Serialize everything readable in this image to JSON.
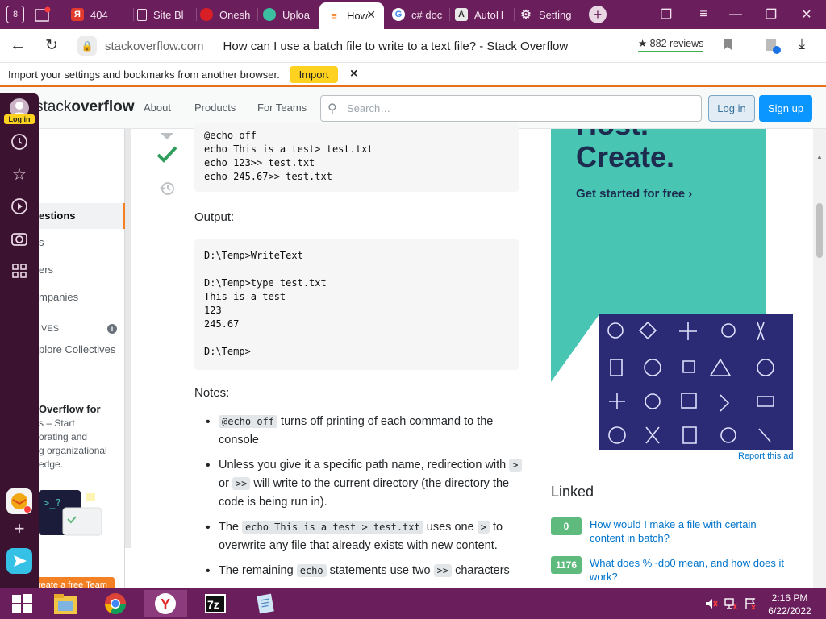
{
  "browser": {
    "tabs": [
      {
        "label": "404",
        "icon": "yandex-icon"
      },
      {
        "label": "Site Bl",
        "icon": "page-icon"
      },
      {
        "label": "Onesh",
        "icon": "red-shoe-icon"
      },
      {
        "label": "Uploa",
        "icon": "cloud-icon"
      },
      {
        "label": "How",
        "icon": "stackoverflow-icon",
        "active": true
      },
      {
        "label": "c# doc",
        "icon": "google-icon"
      },
      {
        "label": "AutoH",
        "icon": "autohotkey-icon"
      },
      {
        "label": "Setting",
        "icon": "gear-icon"
      }
    ],
    "tab_counter": "8",
    "domain": "stackoverflow.com",
    "page_title": "How can I use a batch file to write to a text file? - Stack Overflow",
    "reviews": "★ 882 reviews",
    "infobar_text": "Import your settings and bookmarks from another browser.",
    "infobar_button": "Import",
    "infobar_close": "×",
    "login_badge": "Log in"
  },
  "so": {
    "logo_text_a": "stack",
    "logo_text_b": "overflow",
    "nav": [
      "About",
      "Products",
      "For Teams"
    ],
    "search_placeholder": "Search…",
    "login": "Log in",
    "signup": "Sign up",
    "left_nav": {
      "questions": "estions",
      "tags": "s",
      "users": "ers",
      "companies": "mpanies",
      "collectives_header": "IVES",
      "explore": "plore Collectives"
    },
    "teams_promo": {
      "title": "Overflow for",
      "line1": "s – Start",
      "line2": "orating and",
      "line3": "g organizational",
      "line4": "edge.",
      "button": "Create a free Team"
    }
  },
  "answer": {
    "code1": "@echo off\necho This is a test> test.txt\necho 123>> test.txt\necho 245.67>> test.txt",
    "output_label": "Output:",
    "code2": "D:\\Temp>WriteText\n\nD:\\Temp>type test.txt\nThis is a test\n123\n245.67\n\nD:\\Temp>",
    "notes_label": "Notes:",
    "notes": [
      {
        "code": "@echo off",
        "text": " turns off printing of each command to the console"
      },
      {
        "pre": "Unless you give it a specific path name, redirection with ",
        "c1": ">",
        "mid": " or ",
        "c2": ">>",
        "post": " will write to the current directory (the directory the code is being run in)."
      },
      {
        "pre": "The ",
        "c1": "echo This is a test > test.txt",
        "post": " uses one ",
        "c2": ">",
        "tail": " to overwrite any file that already exists with new content."
      },
      {
        "pre": "The remaining ",
        "c1": "echo",
        "mid": " statements use two ",
        "c2": ">>",
        "post": " characters"
      }
    ]
  },
  "ad": {
    "headline_top": "Host.",
    "headline": "Create.",
    "cta": "Get started for free ›",
    "report": "Report this ad"
  },
  "linked": {
    "title": "Linked",
    "items": [
      {
        "votes": "0",
        "text": "How would I make a file with certain content in batch?"
      },
      {
        "votes": "1176",
        "text": "What does %~dp0 mean, and how does it work?"
      }
    ]
  },
  "taskbar": {
    "time": "2:16 PM",
    "date": "6/22/2022"
  },
  "colors": {
    "tabstrip": "#6b1e5c",
    "so_blue": "#0a95ff",
    "accepted_green": "#2f9e5c",
    "ad_teal": "#48c5b3",
    "ad_navy": "#2b2a74"
  }
}
